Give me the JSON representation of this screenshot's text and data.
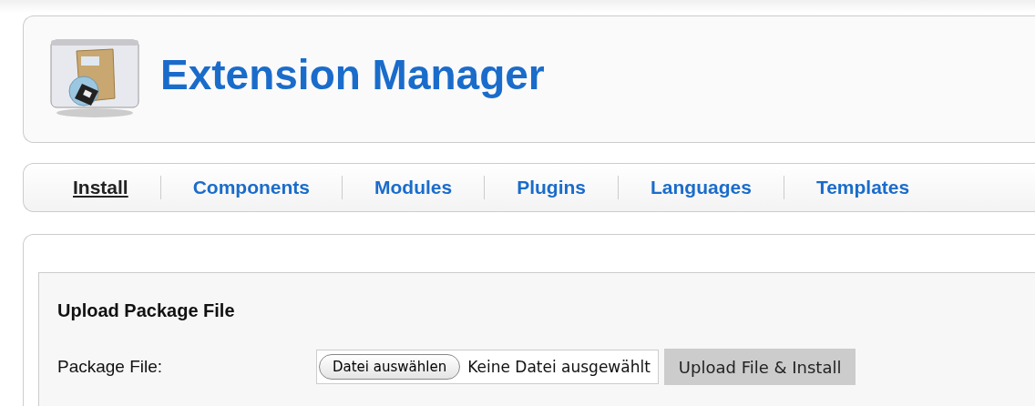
{
  "header": {
    "title": "Extension Manager"
  },
  "tabs": [
    {
      "label": "Install",
      "selected": true
    },
    {
      "label": "Components",
      "selected": false
    },
    {
      "label": "Modules",
      "selected": false
    },
    {
      "label": "Plugins",
      "selected": false
    },
    {
      "label": "Languages",
      "selected": false
    },
    {
      "label": "Templates",
      "selected": false
    }
  ],
  "upload": {
    "heading": "Upload Package File",
    "field_label": "Package File:",
    "choose_button": "Datei auswählen",
    "file_status": "Keine Datei ausgewählt",
    "submit_button": "Upload File & Install"
  }
}
